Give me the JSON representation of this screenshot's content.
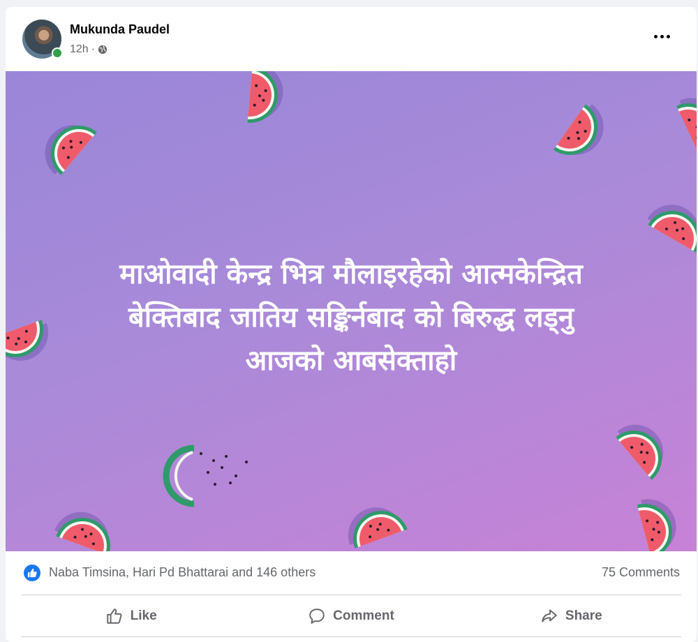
{
  "post": {
    "author": "Mukunda Paudel",
    "time": "12h",
    "separator": "·",
    "privacy_icon": "globe-icon",
    "text_lines": [
      "माओवादी केन्द्र भित्र मौलाइरहेको आत्मकेन्द्रित",
      "बेक्तिबाद जातिय सङ्किर्नबाद को बिरुद्ध लड्नु",
      "आजको आबसेक्ताहो"
    ],
    "background_colors": [
      "#9a86d8",
      "#c782d6"
    ]
  },
  "reactions": {
    "icon": "like-icon",
    "summary": "Naba Timsina, Hari Pd Bhattarai and 146 others",
    "comments": "75 Comments"
  },
  "actions": {
    "like": "Like",
    "comment": "Comment",
    "share": "Share"
  },
  "colors": {
    "accent": "#1877f2",
    "online": "#31a24c",
    "muted_text": "#65676b"
  }
}
